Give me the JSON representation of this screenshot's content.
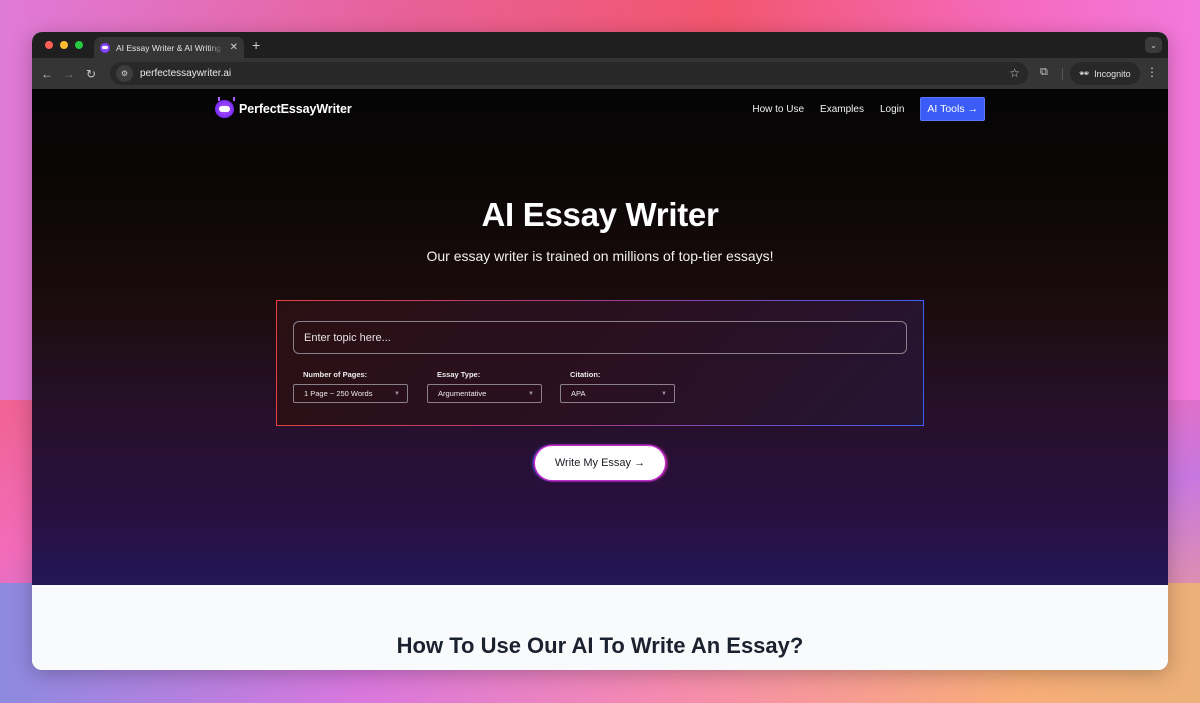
{
  "browser": {
    "tab": {
      "title": "AI Essay Writer & AI Writing Tool",
      "favicon": "robot-favicon",
      "close_glyph": "✕"
    },
    "new_tab_glyph": "+",
    "tab_dropdown_glyph": "⌄",
    "nav": {
      "back": "←",
      "forward": "→",
      "reload": "↻"
    },
    "url": "perfectessaywriter.ai",
    "site_info_glyph": "⚙",
    "bookmark_glyph": "☆",
    "extensions_glyph": "⧉",
    "incognito_glyph": "🕶",
    "incognito_label": "Incognito",
    "menu_glyph": "⋮"
  },
  "site": {
    "logo_text": "PerfectEssayWriter",
    "nav_links": [
      "How to Use",
      "Examples",
      "Login"
    ],
    "cta_label": "AI Tools →",
    "cta_color": "#3b5cf6"
  },
  "hero": {
    "title": "AI Essay Writer",
    "subtitle": "Our essay writer is trained on millions of top-tier essays!",
    "topic_placeholder": "Enter topic here...",
    "fields": [
      {
        "label": "Number of Pages:",
        "value": "1 Page ~ 250 Words"
      },
      {
        "label": "Essay Type:",
        "value": "Argumentative"
      },
      {
        "label": "Citation:",
        "value": "APA"
      }
    ],
    "caret_glyph": "▼",
    "submit_label": "Write My Essay →"
  },
  "section": {
    "title": "How To Use Our AI To Write An Essay?"
  }
}
